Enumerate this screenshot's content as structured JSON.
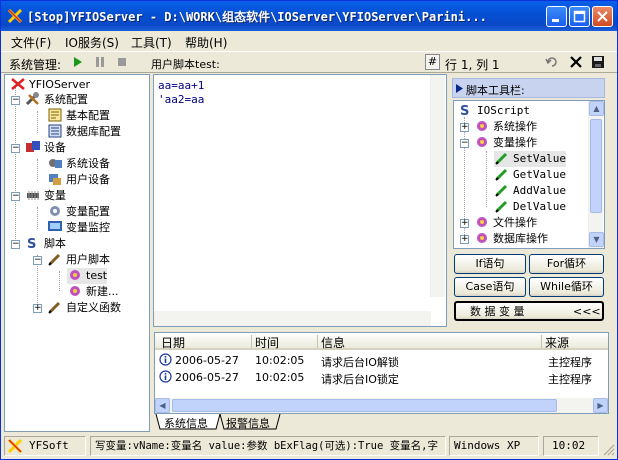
{
  "window": {
    "title": "[Stop]YFIOServer - D:\\WORK\\组态软件\\IOServer\\YFIOServer\\Parini..."
  },
  "menu": [
    "文件(F)",
    "IO服务(S)",
    "工具(T)",
    "帮助(H)"
  ],
  "toolbar": {
    "sys_label": "系统管理:",
    "script_label": "用户脚本test:",
    "hash": "#",
    "position": "行 1, 列 1"
  },
  "tree": {
    "root": "YFIOServer",
    "system_config": "系统配置",
    "basic_config": "基本配置",
    "db_config": "数据库配置",
    "device": "设备",
    "sys_device": "系统设备",
    "user_device": "用户设备",
    "variable": "变量",
    "var_config": "变量配置",
    "var_monitor": "变量监控",
    "script": "脚本",
    "user_script": "用户脚本",
    "test": "test",
    "new": "新建...",
    "custom_func": "自定义函数"
  },
  "editor": {
    "line1": "aa=aa+1",
    "line2": "'aa2=aa"
  },
  "script_toolbar": {
    "title": "脚本工具栏:",
    "root": "IOScript",
    "items": [
      "系统操作",
      "变量操作",
      "SetValue",
      "GetValue",
      "AddValue",
      "DelValue",
      "文件操作",
      "数据库操作"
    ],
    "btn_if": "If语句",
    "btn_for": "For循环",
    "btn_case": "Case语句",
    "btn_while": "While循环",
    "btn_var": "数 据 变 量",
    "btn_arrows": "<<<"
  },
  "log": {
    "headers": [
      "日期",
      "时间",
      "信息",
      "来源"
    ],
    "rows": [
      {
        "date": "2006-05-27",
        "time": "10:02:05",
        "info": "请求后台IO解锁",
        "source": "主控程序"
      },
      {
        "date": "2006-05-27",
        "time": "10:02:05",
        "info": "请求后台IO锁定",
        "source": "主控程序"
      }
    ],
    "tabs": [
      "系统信息",
      "报警信息"
    ]
  },
  "status": {
    "app": "YFSoft",
    "message": "写变量:vName:变量名 value:参数 bExFlag(可选):True 变量名,字",
    "os": "Windows XP",
    "time": "10:02"
  },
  "colors": {
    "titlebar": "#0a5fe8",
    "panel_header": "#c8d3f0",
    "code": "#00007f"
  }
}
